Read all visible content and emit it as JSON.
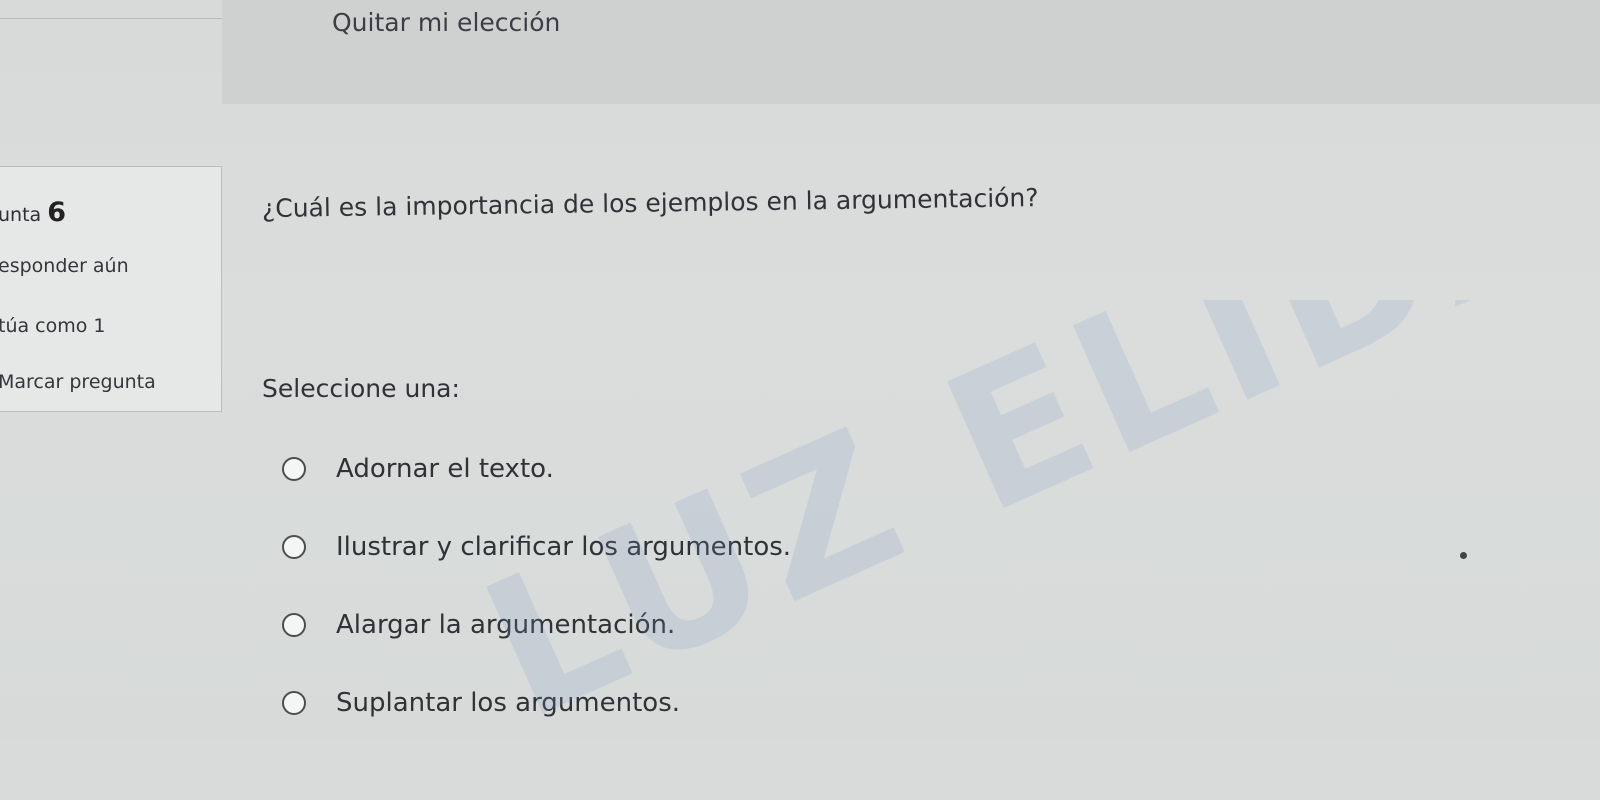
{
  "previous_question": {
    "clear_choice_label": "Quitar mi elección"
  },
  "question_info": {
    "number_label": "unta",
    "number": "6",
    "state": "esponder aún",
    "grade": "túa como 1",
    "flag_label": "Marcar pregunta"
  },
  "question": {
    "text": "¿Cuál es la importancia de los ejemplos en la argumentación?",
    "prompt": "Seleccione una:",
    "options": [
      "Adornar el texto.",
      "Ilustrar y clarificar los argumentos.",
      "Alargar la argumentación.",
      "Suplantar los argumentos."
    ]
  },
  "watermark": "LUZ ELIDA ALZAT"
}
